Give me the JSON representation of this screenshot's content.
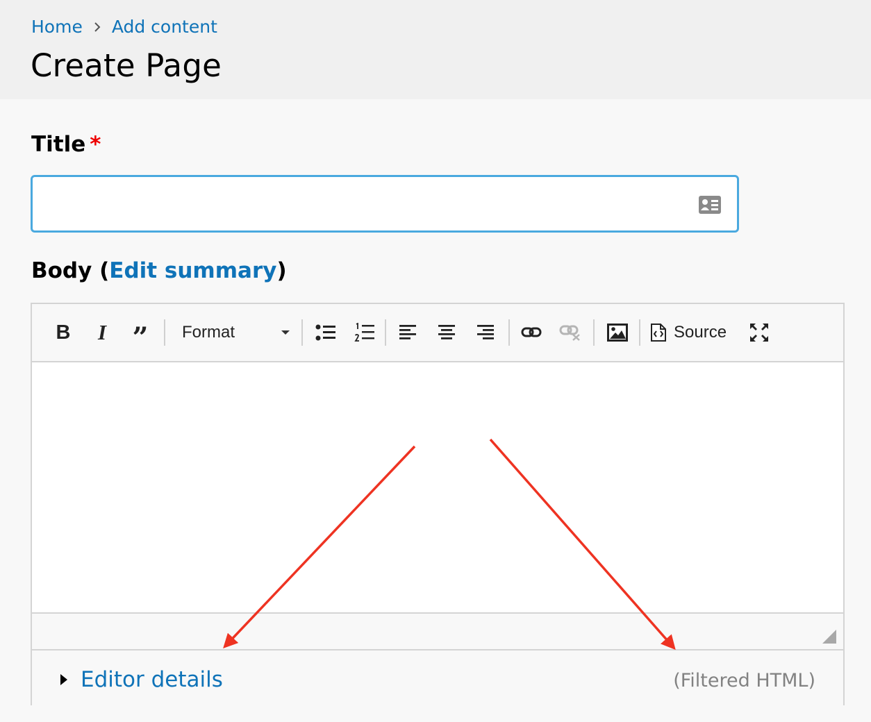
{
  "breadcrumb": {
    "home": "Home",
    "add_content": "Add content"
  },
  "page_title": "Create Page",
  "title_field": {
    "label": "Title",
    "required_marker": "*",
    "value": "",
    "icon": "contact-card-icon"
  },
  "body_field": {
    "label_prefix": "Body (",
    "edit_summary": "Edit summary",
    "label_suffix": ")"
  },
  "toolbar": {
    "bold": "B",
    "italic": "I",
    "blockquote": "”",
    "format_label": "Format",
    "source_label": "Source",
    "icons": [
      "bold-icon",
      "italic-icon",
      "blockquote-icon",
      "bulleted-list-icon",
      "numbered-list-icon",
      "align-left-icon",
      "align-center-icon",
      "align-right-icon",
      "link-icon",
      "unlink-icon",
      "image-icon",
      "source-icon",
      "maximize-icon"
    ],
    "unlink_disabled": true
  },
  "editor_footer": {
    "details_label": "Editor details",
    "text_format": "(Filtered HTML)"
  },
  "colors": {
    "link": "#0f73b8",
    "required": "#ee0000",
    "input_focus_border": "#4aa9df",
    "annotation_arrow": "#ee3322"
  }
}
